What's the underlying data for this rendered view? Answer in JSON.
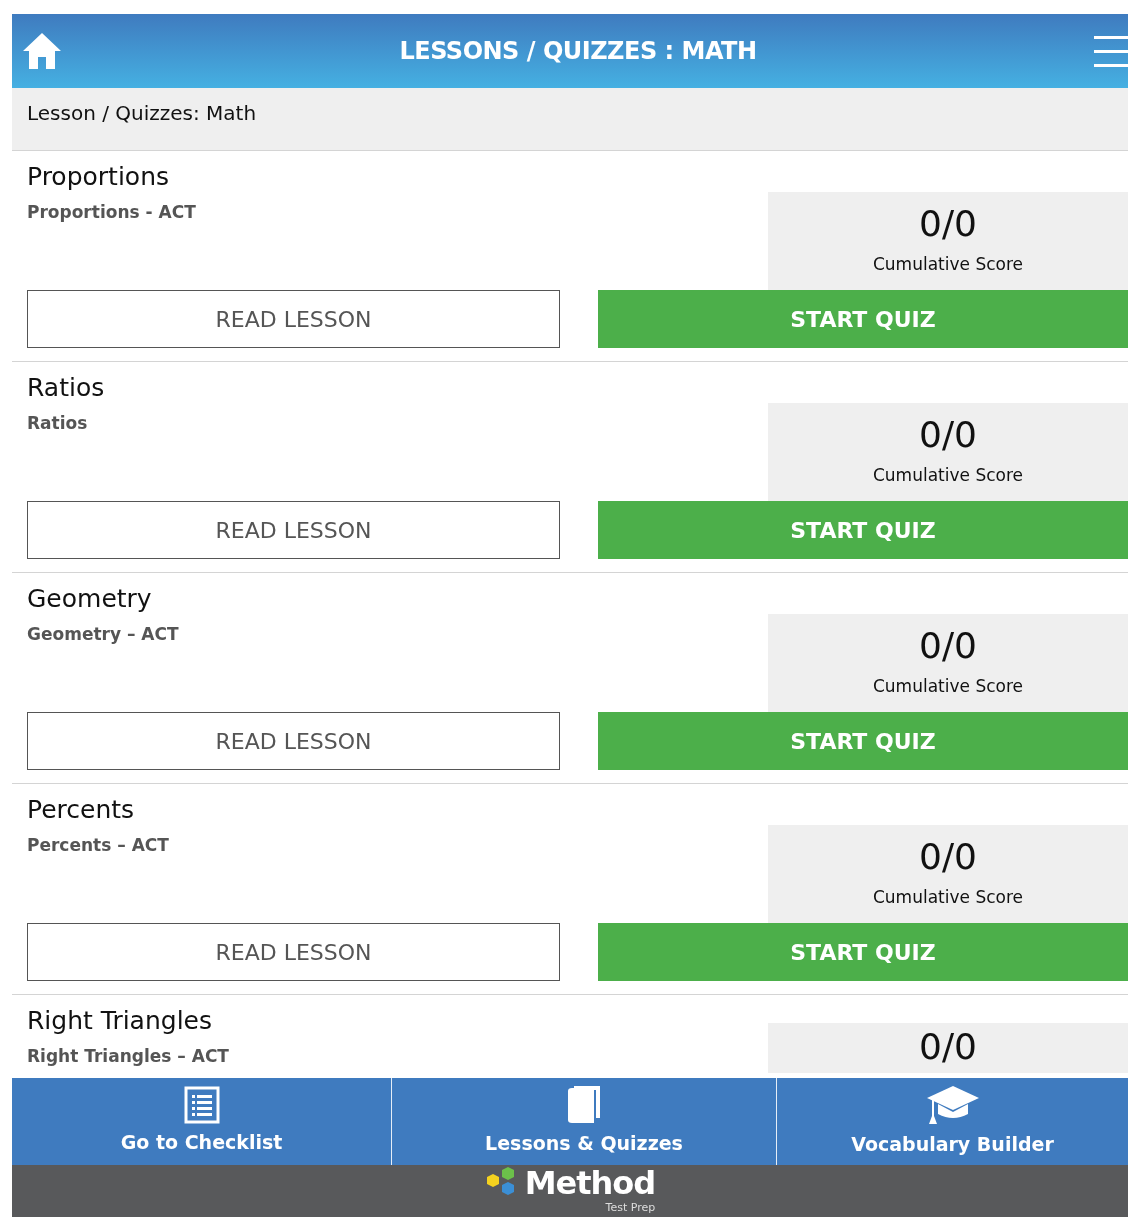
{
  "header": {
    "title": "LESSONS / QUIZZES : MATH"
  },
  "breadcrumb": "Lesson / Quizzes: Math",
  "lessons": [
    {
      "title": "Proportions",
      "subtitle": "Proportions - ACT",
      "score": "0/0",
      "score_label": "Cumulative Score",
      "read_button": "READ LESSON",
      "quiz_button": "START QUIZ"
    },
    {
      "title": "Ratios",
      "subtitle": "Ratios",
      "score": "0/0",
      "score_label": "Cumulative Score",
      "read_button": "READ LESSON",
      "quiz_button": "START QUIZ"
    },
    {
      "title": "Geometry",
      "subtitle": "Geometry – ACT",
      "score": "0/0",
      "score_label": "Cumulative Score",
      "read_button": "READ LESSON",
      "quiz_button": "START QUIZ"
    },
    {
      "title": "Percents",
      "subtitle": "Percents – ACT",
      "score": "0/0",
      "score_label": "Cumulative Score",
      "read_button": "READ LESSON",
      "quiz_button": "START QUIZ"
    },
    {
      "title": "Right Triangles",
      "subtitle": "Right Triangles – ACT",
      "score": "0/0"
    }
  ],
  "bottom_nav": [
    {
      "kind": "checklist",
      "label": "Go to Checklist"
    },
    {
      "kind": "book",
      "label": "Lessons & Quizzes"
    },
    {
      "kind": "cap",
      "label": "Vocabulary Builder"
    }
  ],
  "footer": {
    "logo": "Method",
    "tagline": "Test Prep"
  }
}
